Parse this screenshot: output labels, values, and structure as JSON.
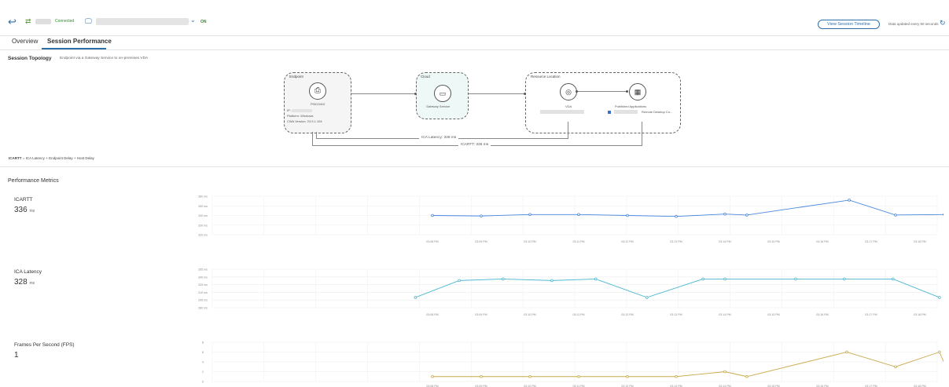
{
  "header": {
    "connection_status": "Connected",
    "power_status": "ON",
    "timeline_button": "View Session Timeline",
    "updated_text": "Data updated every 60 seconds"
  },
  "tabs": [
    {
      "label": "Overview"
    },
    {
      "label": "Session Performance"
    }
  ],
  "topology": {
    "title": "Session Topology",
    "description": "Endpoint via a Gateway Service to on-premises VDA",
    "endpoint": {
      "label": "Endpoint",
      "name": "P0013410",
      "ip_label": "IP:",
      "platform": "Platform: Windows",
      "cwa_version": "CWA Version: 23.9.1.104"
    },
    "cloud": {
      "label": "Cloud",
      "service": "Gateway Service"
    },
    "resource_location": {
      "label": "Resource Location",
      "vda": "VDA",
      "apps": "Published Applications",
      "app_item": "Remote Desktop Co..."
    },
    "ica_latency_label": "ICA Latency: 328 ms",
    "icartt_label": "ICARTT: 336 ms",
    "formula": {
      "icartt": "ICARTT",
      "eq": "=",
      "ica": "ICA Latency",
      "plus1": "+",
      "endpoint_delay": "Endpoint Delay",
      "plus2": "+",
      "host_delay": "Host Delay"
    }
  },
  "performance": {
    "title": "Performance Metrics",
    "metrics": [
      {
        "name": "ICARTT",
        "value": "336",
        "unit": "ms"
      },
      {
        "name": "ICA Latency",
        "value": "328",
        "unit": "ms"
      },
      {
        "name": "Frames Per Second (FPS)",
        "value": "1",
        "unit": ""
      }
    ]
  },
  "chart_data": [
    {
      "type": "line",
      "title": "ICARTT",
      "color": "#4a86e0",
      "y_ticks": [
        "360 ms",
        "350 ms",
        "340 ms",
        "330 ms",
        "320 ms"
      ],
      "ylim": [
        320,
        360
      ],
      "x_ticks": [
        "03:08 PM",
        "03:09 PM",
        "03:10 PM",
        "03:11 PM",
        "03:12 PM",
        "03:13 PM",
        "03:14 PM",
        "03:15 PM",
        "03:16 PM",
        "03:17 PM",
        "03:18 PM"
      ],
      "points_x": [
        0,
        1,
        2,
        3,
        4,
        5,
        6,
        6.45,
        8.55,
        9.5,
        10.5,
        10.75
      ],
      "points_y": [
        340,
        339.5,
        341,
        341,
        340,
        339,
        341.5,
        340.5,
        356,
        340.5,
        341,
        340.2
      ],
      "xlim": [
        -0.35,
        10.85
      ]
    },
    {
      "type": "line",
      "title": "ICA Latency",
      "color": "#4bb8d0",
      "y_ticks": [
        "355 ms",
        "340 ms",
        "325 ms",
        "310 ms",
        "295 ms",
        "280 ms"
      ],
      "ylim": [
        280,
        355
      ],
      "x_ticks": [
        "03:08 PM",
        "03:09 PM",
        "03:10 PM",
        "03:11 PM",
        "03:12 PM",
        "03:13 PM",
        "03:14 PM",
        "03:15 PM",
        "03:16 PM",
        "03:17 PM",
        "03:18 PM"
      ],
      "points_x": [
        -0.35,
        0.55,
        1.45,
        2.45,
        3.35,
        4.4,
        5.55,
        6.0,
        7.45,
        8.45,
        9.45,
        10.4
      ],
      "points_y": [
        300,
        333,
        336,
        333,
        336,
        300,
        336,
        336,
        336,
        336,
        336,
        300
      ],
      "xlim": [
        -0.6,
        10.7
      ]
    },
    {
      "type": "line",
      "title": "Frames Per Second (FPS)",
      "color": "#c9a94a",
      "y_ticks": [
        "8",
        "6",
        "4",
        "2",
        "0"
      ],
      "ylim": [
        0,
        8
      ],
      "x_ticks": [
        "03:08 PM",
        "03:09 PM",
        "03:10 PM",
        "03:11 PM",
        "03:12 PM",
        "03:13 PM",
        "03:14 PM",
        "03:15 PM",
        "03:16 PM",
        "03:17 PM",
        "03:18 PM"
      ],
      "points_x": [
        0,
        1,
        2,
        3,
        4,
        5,
        6,
        6.45,
        8.5,
        9.5,
        10.4,
        10.62
      ],
      "points_y": [
        1,
        1,
        1,
        1,
        1,
        1,
        2,
        1,
        6,
        3,
        6,
        1
      ],
      "xlim": [
        -0.35,
        10.75
      ]
    }
  ]
}
